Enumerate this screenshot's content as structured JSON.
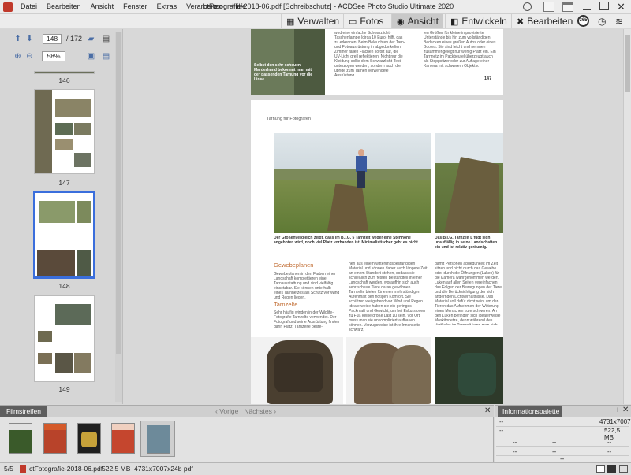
{
  "window": {
    "title": "ctFotografie-2018-06.pdf [Schreibschutz] - ACDSee Photo Studio Ultimate 2020"
  },
  "menu": [
    "Datei",
    "Bearbeiten",
    "Ansicht",
    "Fenster",
    "Extras",
    "Verarbeiten",
    "Hilfe"
  ],
  "modes": [
    {
      "label": "Verwalten",
      "icon": "grid-icon"
    },
    {
      "label": "Fotos",
      "icon": "photos-icon"
    },
    {
      "label": "Ansicht",
      "icon": "eye-icon"
    },
    {
      "label": "Entwickeln",
      "icon": "develop-icon"
    },
    {
      "label": "Bearbeiten",
      "icon": "edit-icon"
    }
  ],
  "round_badge": "365",
  "nav": {
    "page_value": "148",
    "page_total": "/ 172",
    "zoom_value": "58%"
  },
  "thumbnails": [
    {
      "label": "146"
    },
    {
      "label": "147"
    },
    {
      "label": "148",
      "selected": true
    },
    {
      "label": "149"
    }
  ],
  "document": {
    "page_number": "147",
    "section_title": "Tarnung für Fotografen",
    "top_left_caption": "Selbst den sehr scheuen Marderhund bekommt man mit der passenden Tarnung vor die Linse.",
    "top_text_col1": "wird eine einfache Schwarzlicht-Taschenlampe (circa 10 Euro) hilft, das zu erkennen. Beim Beleuchten der Tarn- und Fotoausrüstung in abgedunkelten Zimmer fallen Flächen sofort auf, die UV-Licht grell reflektieren. Nicht nur die Kleidung sollte dem Schwarzlicht-Test unterzogen werden, sondern auch die übrige zum Tarnen verwendete Ausrüstung.",
    "top_text_col2": "len Größen für kleine improvisierte Unterstände bis hin zum vollständigen Bedecken eines großen Autos oder eines Bootes. Sie sind leicht und nehmen zusammengelegt nur wenig Platz ein. Ein Tarnnetz im Packbeutel überzeugt auch als Stoppsitzer oder zur Auflage einer Kamera mit schwerem Objektiv.",
    "caption_main": "Der Größenvergleich zeigt, dass im B.I.G. 5 Tarnzelt weder eine Stehhöhe angeboten wird, noch viel Platz vorhanden ist. Minimalistischer geht es nicht.",
    "caption_right": "Das B.I.G. Tarnzelt L fügt sich unauffällig in seine Landschaften ein und ist relativ geräumig.",
    "heading1": "Gewebeplanen",
    "body1": "Gewebeplanen in den Farben einer Landschaft komplettieren eine Tarnausstattung und sind vielfältig einsetzbar. Sie können unterhalb eines Tarnnetzes als Schutz vor Wind und Regen liegen.",
    "heading2": "Tarnzelte",
    "body2": "Sehr häufig winden in der Wildlife-Fotografie Tarnzelte verwendet. Der Fotograf und seine Ausrüstung finden darin Platz. Tarnzelte beste-",
    "body3": "hen aus einem witterungsbeständigen Material und können daher auch längere Zeit an einem Standort stehen, sodass sie schließlich zum festen Bestandteil in einer Landschaft werden, woraufhin sich auch sehr scheue Tiere daran gewöhnen. Tarnzelte bieten für einen mehrstündigen Aufenthalt den nötigen Komfort. Sie schützen weitgehend vor Wind und Regen. Idealerweise haben sie ein geringes Packmaß und Gewicht, um bei Exkursionen zu Fuß keine große Last zu sein. Vor Ort muss man sie unkompliziert aufbauen können. Vorzugsweise ist ihre Innenseite schwarz,",
    "body4": "damit Personen abgedunkelt im Zelt sitzen und nicht durch das Gewebe oder durch die Öffnungen (Luken) für die Kamera wahrgenommen werden. Luken auf allen Seiten vereinfachen das Folgen der Bewegungen der Tiere und die Berücksichtigung der sich ändernden Lichtverhältnisse. Das Material soll dafür dicht sein, um den Tieren das Aufnehmen der Witterung eines Menschen zu erschweren. An den Luken befinden sich idealerweise Moskitonetze, denn während des Verbleibs im Tarnzelt kann man sich der lästigen Insekten schwer erwehren."
  },
  "filmstrip": {
    "tab": "Filmstreifen",
    "prev": "Vorige",
    "next": "Nächstes",
    "items": [
      {
        "color": "#3a5a2a"
      },
      {
        "color": "#b8432a"
      },
      {
        "color": "#1f1f1f"
      },
      {
        "color": "#c5462e"
      },
      {
        "color": "#6d8a9a",
        "selected": true
      }
    ]
  },
  "info": {
    "tab": "Informationspalette",
    "dims": "4731x7007",
    "size": "522,5 MB",
    "placeholder": "--"
  },
  "status": {
    "count": "5/5",
    "filename": "ctFotografie-2018-06.pdf",
    "filesize": "522,5 MB",
    "dims": "4731x7007x24b pdf"
  }
}
